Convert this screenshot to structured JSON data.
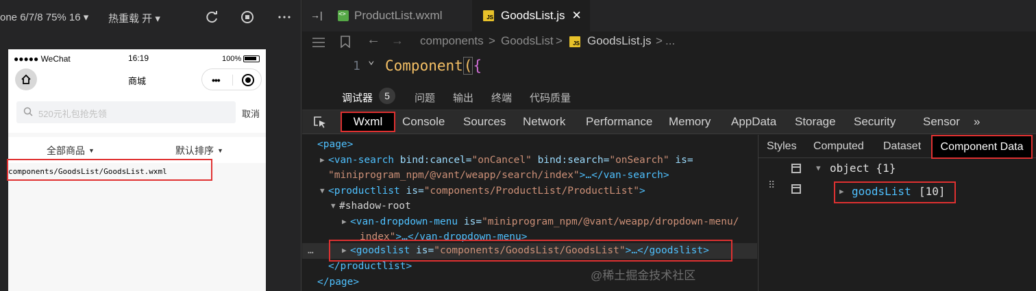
{
  "simulator": {
    "device_label": "one 6/7/8 75% 16 ▾",
    "hot_reload_label": "热重载 开 ▾",
    "status_signal": "●●●●● WeChat",
    "status_time": "16:19",
    "status_battery": "100%",
    "nav_title": "商城",
    "search_placeholder": "520元礼包抢先领",
    "cancel_label": "取消",
    "filter_all": "全部商品",
    "filter_sort": "默认排序",
    "path_text": "components/GoodsList/GoodsList.wxml"
  },
  "editor": {
    "tabs": [
      "ProductList.wxml",
      "GoodsList.js"
    ],
    "breadcrumb": [
      "components",
      ">",
      "GoodsList",
      ">",
      "GoodsList.js",
      ">",
      "..."
    ],
    "code": {
      "line_number": "1",
      "keyword": "Component",
      "paren": "(",
      "brace": "{"
    }
  },
  "devtools": {
    "top_tabs": [
      "调试器",
      "问题",
      "输出",
      "终端",
      "代码质量"
    ],
    "top_badge": "5",
    "panel_tabs": [
      "Wxml",
      "Console",
      "Sources",
      "Network",
      "Performance",
      "Memory",
      "AppData",
      "Storage",
      "Security",
      "Sensor",
      "»"
    ],
    "side_tabs": [
      "Styles",
      "Computed",
      "Dataset",
      "Component Data"
    ],
    "object_label": "object {1}",
    "goods_key": "goodsList",
    "goods_count": "[10]",
    "row_dots": "…"
  },
  "tree": {
    "l1": "<page>",
    "l2_tag": "<van-search",
    "l2_a1": " bind:cancel=",
    "l2_v1": "\"onCancel\"",
    "l2_a2": " bind:search=",
    "l2_v2": "\"onSearch\"",
    "l2_a3": " is=",
    "l3_v": "\"miniprogram_npm/@vant/weapp/search/index\"",
    "l3_end": ">…</van-search>",
    "l4_tag": "<productlist",
    "l4_a": " is=",
    "l4_v": "\"components/ProductList/ProductList\"",
    "l4_end": ">",
    "l5": "#shadow-root",
    "l6_tag": "<van-dropdown-menu",
    "l6_a": " is=",
    "l6_v": "\"miniprogram_npm/@vant/weapp/dropdown-menu/",
    "l7_v": "index\"",
    "l7_end": ">…</van-dropdown-menu>",
    "l8_tag": "<goodslist",
    "l8_a": " is=",
    "l8_v": "\"components/GoodsList/GoodsList\"",
    "l8_end": ">…</goodslist>",
    "l9": "</productlist>",
    "l10": "</page>"
  },
  "watermark": "@稀土掘金技术社区",
  "colors": {
    "highlight_red": "#e03131",
    "tag_blue": "#4fc1ff",
    "value_orange": "#ce9178",
    "code_yellow": "#f5c065"
  }
}
